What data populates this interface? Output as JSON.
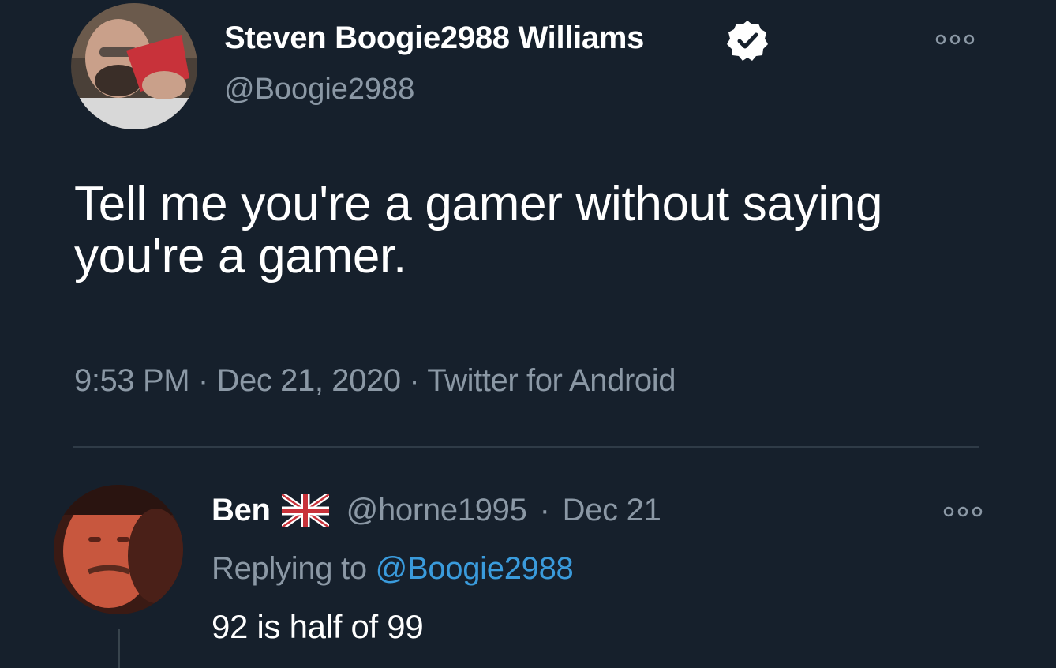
{
  "main_tweet": {
    "author_name": "Steven Boogie2988 Williams",
    "handle": "@Boogie2988",
    "verified_icon": "verified-badge-icon",
    "text": "Tell me you're a gamer without saying you're a gamer.",
    "timestamp": "9:53 PM · Dec 21, 2020 · Twitter for Android",
    "more_icon": "more-options-icon"
  },
  "reply_tweet": {
    "author_name": "Ben",
    "flag_icon": "uk-flag-icon",
    "handle": "@horne1995",
    "separator": "·",
    "date": "Dec 21",
    "replying_label": "Replying to",
    "replying_mention": "@Boogie2988",
    "text": "92 is half of 99",
    "more_icon": "more-options-icon"
  },
  "colors": {
    "background": "#16202c",
    "primary_text": "#ffffff",
    "secondary_text": "#8b98a5",
    "link": "#3a9bdc",
    "divider": "#2f3b47"
  }
}
